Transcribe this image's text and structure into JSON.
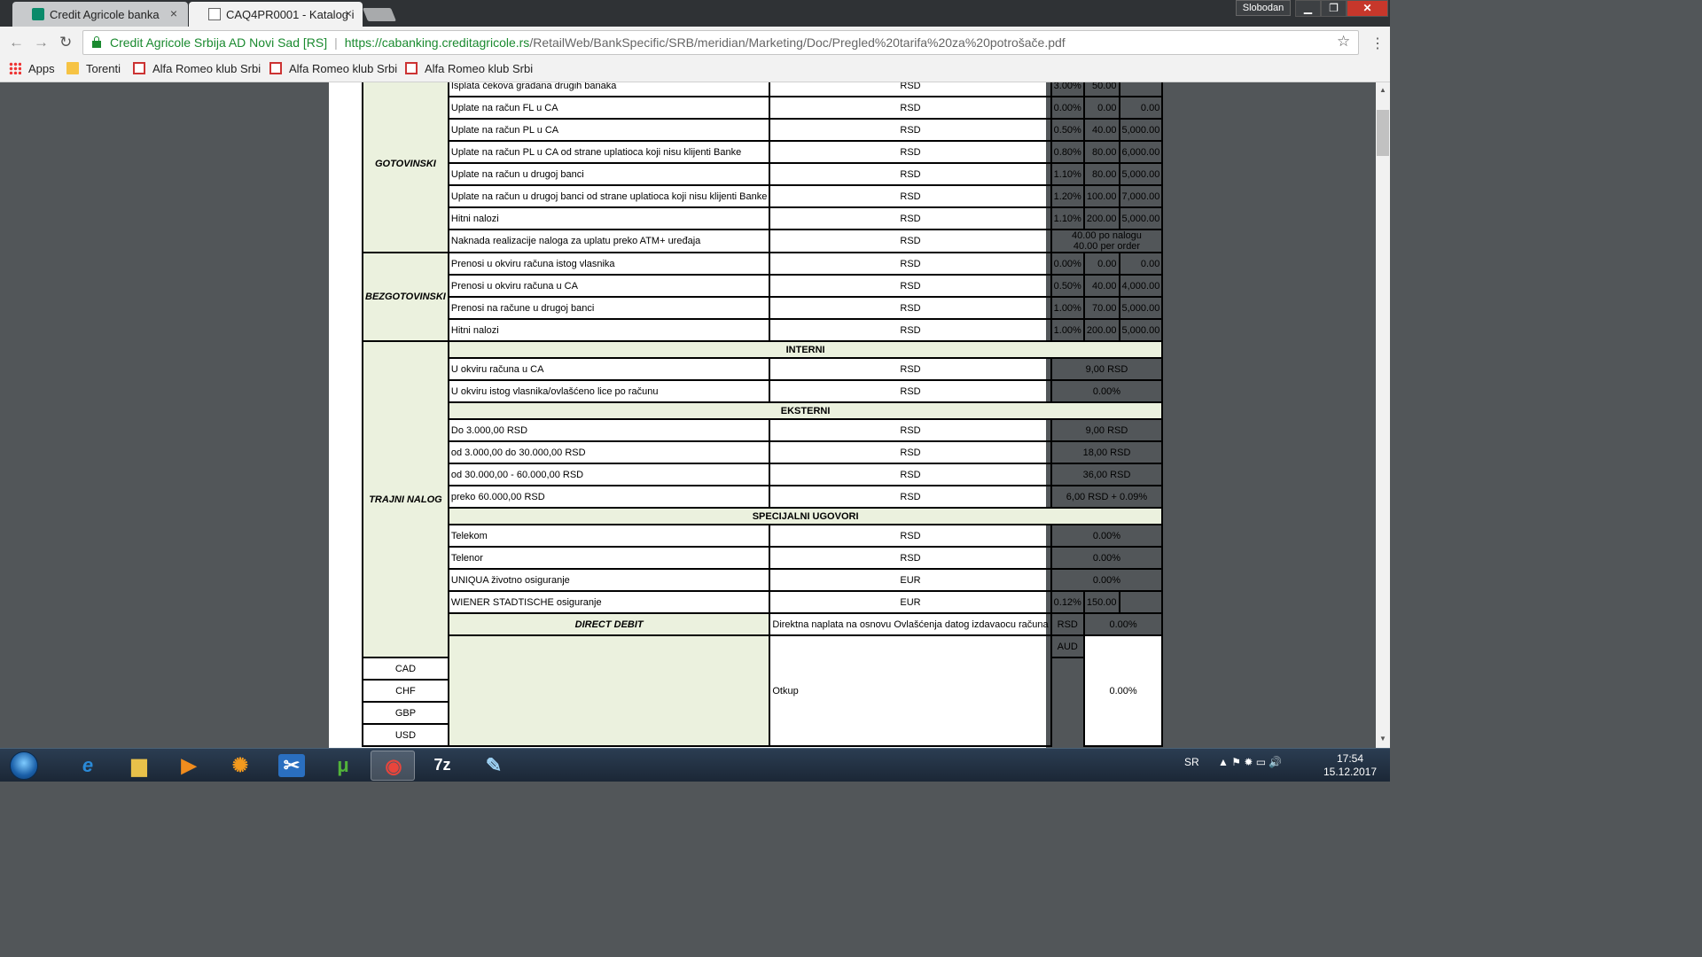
{
  "browser": {
    "tabs": [
      {
        "title": "Credit Agricole banka",
        "close": "×"
      },
      {
        "title": "CAQ4PR0001 - Katalog i",
        "close": "×"
      }
    ],
    "profile_name": "Slobodan",
    "window_controls": {
      "minimize": "▁",
      "maximize": "❐",
      "close": "✕"
    },
    "nav": {
      "back": "←",
      "forward": "→",
      "reload": "↻"
    },
    "address_bar": {
      "site_identity": "Credit Agricole Srbija AD Novi Sad [RS]",
      "separator": "|",
      "url_scheme_host": "https://cabanking.creditagricole.rs",
      "url_path": "/RetailWeb/BankSpecific/SRB/meridian/Marketing/Doc/Pregled%20tarifa%20za%20potrošače.pdf"
    },
    "star": "☆",
    "menu": "⋮",
    "bookmarks": [
      {
        "label": "Apps",
        "icon": "apps-grid-icon"
      },
      {
        "label": "Torenti",
        "icon": "folder-icon"
      },
      {
        "label": "Alfa Romeo klub Srbi",
        "icon": "alfa-romeo-icon"
      },
      {
        "label": "Alfa Romeo klub Srbi",
        "icon": "alfa-romeo-icon"
      },
      {
        "label": "Alfa Romeo klub Srbi",
        "icon": "alfa-romeo-icon"
      }
    ]
  },
  "document": {
    "gotovinski": {
      "category": "GOTOVINSKI",
      "rows": [
        {
          "desc": "Isplata čekova građana drugih banaka",
          "cur": "RSD",
          "pct": "3.00%",
          "min": "50.00",
          "max": ""
        },
        {
          "desc": "Uplate na račun FL u CA",
          "cur": "RSD",
          "pct": "0.00%",
          "min": "0.00",
          "max": "0.00"
        },
        {
          "desc": "Uplate na račun PL u CA",
          "cur": "RSD",
          "pct": "0.50%",
          "min": "40.00",
          "max": "5,000.00"
        },
        {
          "desc": "Uplate na račun PL u CA od strane uplatioca koji nisu klijenti Banke",
          "cur": "RSD",
          "pct": "0.80%",
          "min": "80.00",
          "max": "6,000.00"
        },
        {
          "desc": "Uplate na račun u drugoj banci",
          "cur": "RSD",
          "pct": "1.10%",
          "min": "80.00",
          "max": "5,000.00"
        },
        {
          "desc": "Uplate na račun u drugoj banci od strane uplatioca koji nisu klijenti Banke",
          "cur": "RSD",
          "pct": "1.20%",
          "min": "100.00",
          "max": "7,000.00"
        },
        {
          "desc": "Hitni nalozi",
          "cur": "RSD",
          "pct": "1.10%",
          "min": "200.00",
          "max": "5,000.00"
        }
      ],
      "atm_row": {
        "desc": "Naknada realizacije naloga za uplatu preko ATM+ uređaja",
        "cur": "RSD",
        "line1": "40.00 po nalogu",
        "line2": "40.00 per order"
      }
    },
    "bezgotovinski": {
      "category": "BEZGOTOVINSKI",
      "rows": [
        {
          "desc": "Prenosi u okviru računa istog vlasnika",
          "cur": "RSD",
          "pct": "0.00%",
          "min": "0.00",
          "max": "0.00"
        },
        {
          "desc": "Prenosi u okviru računa u CA",
          "cur": "RSD",
          "pct": "0.50%",
          "min": "40.00",
          "max": "4,000.00"
        },
        {
          "desc": "Prenosi na račune u drugoj banci",
          "cur": "RSD",
          "pct": "1.00%",
          "min": "70.00",
          "max": "5,000.00"
        },
        {
          "desc": "Hitni nalozi",
          "cur": "RSD",
          "pct": "1.00%",
          "min": "200.00",
          "max": "5,000.00"
        }
      ]
    },
    "trajni_nalog": {
      "category": "TRAJNI NALOG",
      "interni_header": "INTERNI",
      "interni": [
        {
          "desc": "U okviru računa u CA",
          "cur": "RSD",
          "fee": "9,00 RSD"
        },
        {
          "desc": "U okviru istog vlasnika/ovlašćeno lice po računu",
          "cur": "RSD",
          "fee": "0.00%"
        }
      ],
      "eksterni_header": "EKSTERNI",
      "eksterni": [
        {
          "desc": "Do 3.000,00 RSD",
          "cur": "RSD",
          "fee": "9,00 RSD"
        },
        {
          "desc": "od 3.000,00 do 30.000,00 RSD",
          "cur": "RSD",
          "fee": "18,00 RSD"
        },
        {
          "desc": "od 30.000,00 - 60.000,00 RSD",
          "cur": "RSD",
          "fee": "36,00 RSD"
        },
        {
          "desc": "preko 60.000,00 RSD",
          "cur": "RSD",
          "fee": "6,00 RSD + 0.09%"
        }
      ],
      "specijalni_header": "SPECIJALNI UGOVORI",
      "specijalni": [
        {
          "desc": "Telekom",
          "cur": "RSD",
          "fee": "0.00%"
        },
        {
          "desc": "Telenor",
          "cur": "RSD",
          "fee": "0.00%"
        },
        {
          "desc": "UNIQUA životno osiguranje",
          "cur": "EUR",
          "fee": "0.00%"
        }
      ],
      "wiener": {
        "desc": "WIENER STADTISCHE osiguranje",
        "cur": "EUR",
        "pct": "0.12%",
        "min": "150.00",
        "max": ""
      }
    },
    "direct_debit": {
      "category": "DIRECT DEBIT",
      "desc": "Direktna naplata na osnovu Ovlašćenja datog izdavaocu računa",
      "cur": "RSD",
      "fee": "0.00%"
    },
    "otkup": {
      "desc": "Otkup",
      "fee": "0.00%",
      "currencies": [
        "AUD",
        "CAD",
        "CHF",
        "GBP",
        "USD"
      ]
    }
  },
  "scrollbar": {
    "up": "▲",
    "down": "▼"
  },
  "taskbar": {
    "apps": [
      {
        "name": "internet-explorer",
        "glyph": "e",
        "color": "#2a8ad8"
      },
      {
        "name": "file-explorer",
        "glyph": "▆",
        "color": "#e8c14a"
      },
      {
        "name": "media-player",
        "glyph": "▶",
        "color": "#f08c1e"
      },
      {
        "name": "helm-app",
        "glyph": "✺",
        "color": "#f39a1e"
      },
      {
        "name": "snipping-tool",
        "glyph": "✂",
        "color": "#ffffff"
      },
      {
        "name": "utorrent",
        "glyph": "μ",
        "color": "#52b43a"
      },
      {
        "name": "chrome",
        "glyph": "◉",
        "color": "#e8453c"
      },
      {
        "name": "7zip",
        "glyph": "7z",
        "color": "#ffffff"
      },
      {
        "name": "paint",
        "glyph": "✎",
        "color": "#9fd3f5"
      }
    ],
    "tray_lang": "SR",
    "tray_icons": "▲  ⚑  ✹  ▭  🔊",
    "time": "17:54",
    "date": "15.12.2017"
  }
}
